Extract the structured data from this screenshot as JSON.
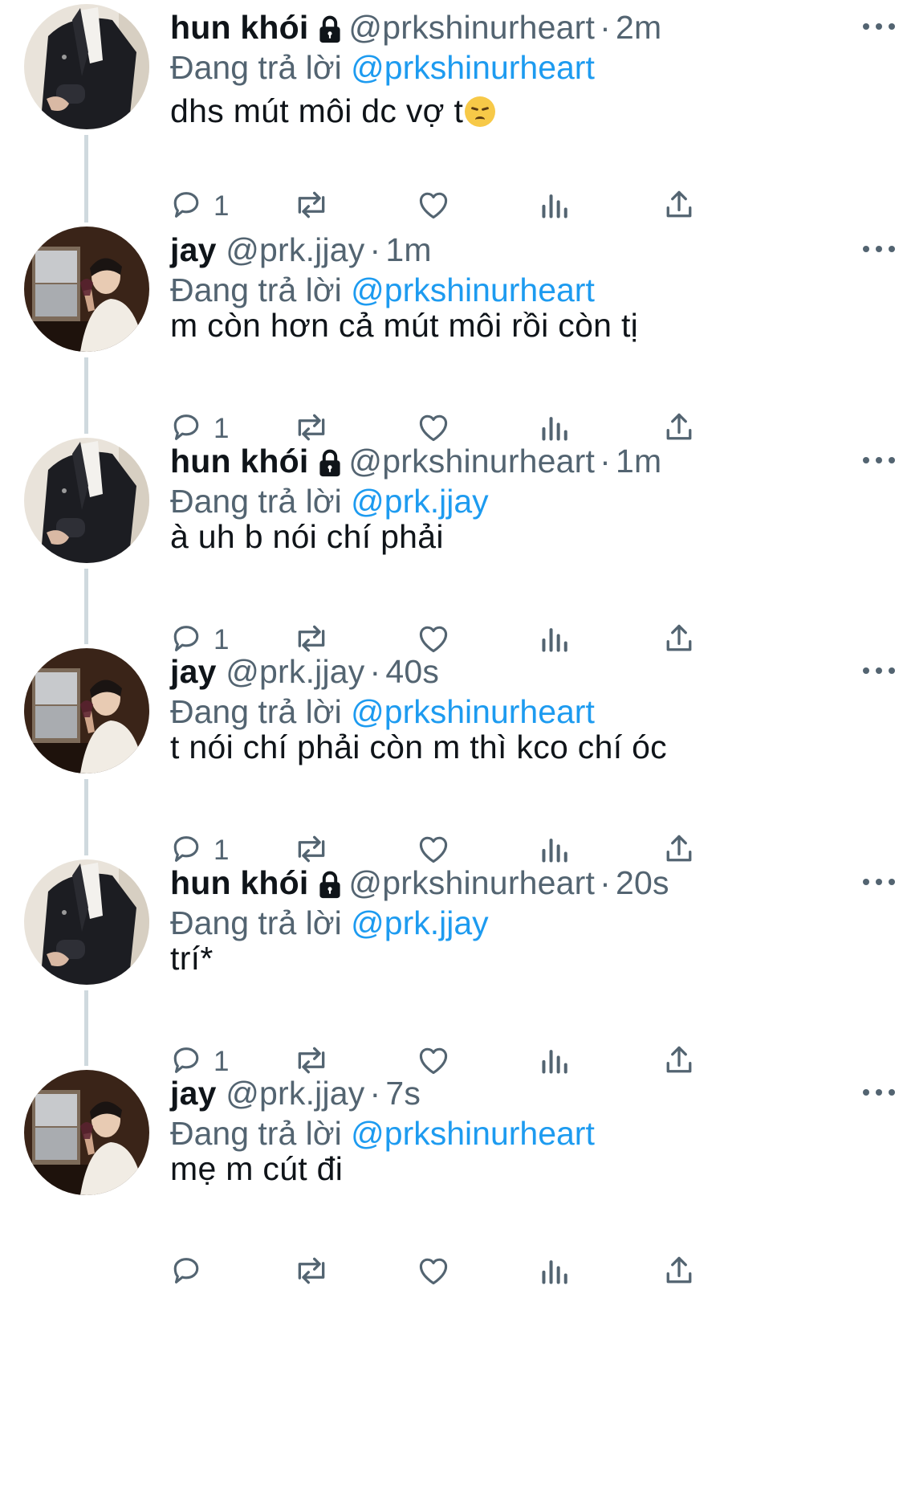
{
  "tweets": [
    {
      "author": "hun khói",
      "locked": true,
      "handle": "@prkshinurheart",
      "time": "2m",
      "replying_label": "Đang trả lời",
      "replying_to": "@prkshinurheart",
      "text": "dhs mút môi dc vợ t",
      "emoji": "disappointed-face",
      "reply_count": "1",
      "avatar": "dark-jacket"
    },
    {
      "author": "jay",
      "locked": false,
      "handle": "@prk.jjay",
      "time": "1m",
      "replying_label": "Đang trả lời",
      "replying_to": "@prkshinurheart",
      "text": "m còn hơn cả mút môi rồi còn tị",
      "reply_count": "1",
      "avatar": "white-shirt"
    },
    {
      "author": "hun khói",
      "locked": true,
      "handle": "@prkshinurheart",
      "time": "1m",
      "replying_label": "Đang trả lời",
      "replying_to": "@prk.jjay",
      "text": "à uh b nói chí phải",
      "reply_count": "1",
      "avatar": "dark-jacket"
    },
    {
      "author": "jay",
      "locked": false,
      "handle": "@prk.jjay",
      "time": "40s",
      "replying_label": "Đang trả lời",
      "replying_to": "@prkshinurheart",
      "text": "t nói chí phải còn m thì kco chí óc",
      "reply_count": "1",
      "avatar": "white-shirt"
    },
    {
      "author": "hun khói",
      "locked": true,
      "handle": "@prkshinurheart",
      "time": "20s",
      "replying_label": "Đang trả lời",
      "replying_to": "@prk.jjay",
      "text": "trí*",
      "reply_count": "1",
      "avatar": "dark-jacket"
    },
    {
      "author": "jay",
      "locked": false,
      "handle": "@prk.jjay",
      "time": "7s",
      "replying_label": "Đang trả lời",
      "replying_to": "@prkshinurheart",
      "text": "mẹ m cút đi",
      "reply_count": "",
      "avatar": "white-shirt"
    }
  ],
  "colors": {
    "text": "#0f1419",
    "secondary": "#536471",
    "mention": "#1d9bf0",
    "thread_line": "#cfd9de"
  }
}
